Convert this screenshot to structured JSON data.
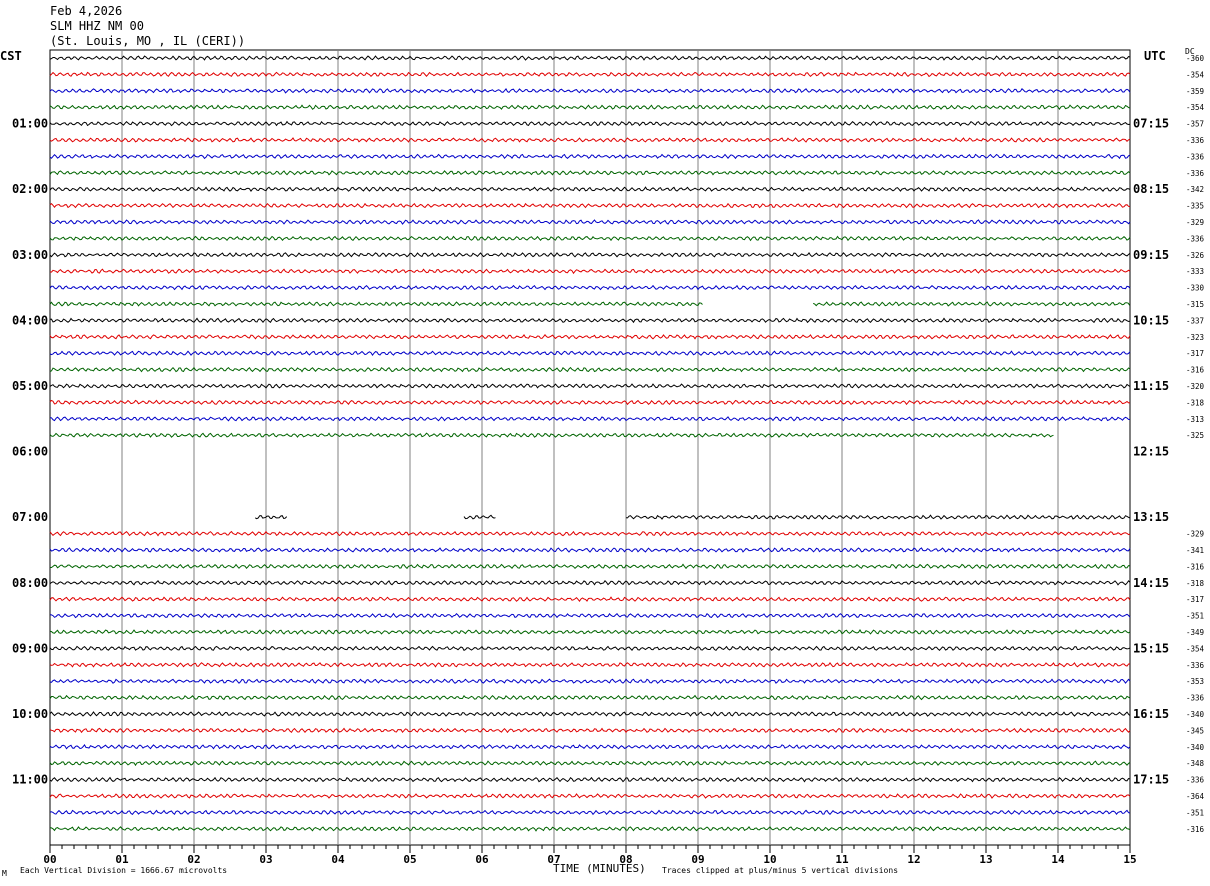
{
  "header": {
    "date": "Feb 4,2026",
    "station": "SLM HHZ NM 00",
    "location": "(St. Louis, MO , IL (CERI))"
  },
  "labels": {
    "left_tz": "CST",
    "right_tz": "UTC",
    "dc_header": "DC"
  },
  "footer": {
    "left": "Each Vertical Division = 1666.67 microvolts",
    "center": "TIME (MINUTES)",
    "right": "Traces clipped at plus/minus 5 vertical divisions",
    "mark": "M"
  },
  "chart_data": {
    "type": "line",
    "xlabel": "TIME (MINUTES)",
    "xlim": [
      0,
      15
    ],
    "x_ticks": [
      "00",
      "01",
      "02",
      "03",
      "04",
      "05",
      "06",
      "07",
      "08",
      "09",
      "10",
      "11",
      "12",
      "13",
      "14",
      "15"
    ],
    "trace_colors": [
      "#000000",
      "#e00000",
      "#0000c8",
      "#006400"
    ],
    "left_time_labels": [
      "01:00",
      "02:00",
      "03:00",
      "04:00",
      "05:00",
      "06:00",
      "07:00",
      "08:00",
      "09:00",
      "10:00",
      "11:00"
    ],
    "right_time_labels": [
      "07:15",
      "08:15",
      "09:15",
      "10:15",
      "11:15",
      "12:15",
      "13:15",
      "14:15",
      "15:15",
      "16:15",
      "17:15"
    ],
    "traces": [
      {
        "dc": "-360",
        "segments": [
          [
            0,
            15
          ]
        ]
      },
      {
        "dc": "-354",
        "segments": [
          [
            0,
            15
          ]
        ]
      },
      {
        "dc": "-359",
        "segments": [
          [
            0,
            15
          ]
        ]
      },
      {
        "dc": "-354",
        "segments": [
          [
            0,
            15
          ]
        ]
      },
      {
        "dc": "-357",
        "segments": [
          [
            0,
            15
          ]
        ]
      },
      {
        "dc": "-336",
        "segments": [
          [
            0,
            15
          ]
        ]
      },
      {
        "dc": "-336",
        "segments": [
          [
            0,
            15
          ]
        ]
      },
      {
        "dc": "-336",
        "segments": [
          [
            0,
            15
          ]
        ]
      },
      {
        "dc": "-342",
        "segments": [
          [
            0,
            15
          ]
        ]
      },
      {
        "dc": "-335",
        "segments": [
          [
            0,
            15
          ]
        ]
      },
      {
        "dc": "-329",
        "segments": [
          [
            0,
            15
          ]
        ]
      },
      {
        "dc": "-336",
        "segments": [
          [
            0,
            15
          ]
        ]
      },
      {
        "dc": "-326",
        "segments": [
          [
            0,
            15
          ]
        ]
      },
      {
        "dc": "-333",
        "segments": [
          [
            0,
            15
          ]
        ]
      },
      {
        "dc": "-330",
        "segments": [
          [
            0,
            15
          ]
        ]
      },
      {
        "dc": "-315",
        "segments": [
          [
            0,
            9.08
          ],
          [
            10.6,
            15
          ]
        ]
      },
      {
        "dc": "-337",
        "segments": [
          [
            0,
            15
          ]
        ]
      },
      {
        "dc": "-323",
        "segments": [
          [
            0,
            15
          ]
        ]
      },
      {
        "dc": "-317",
        "segments": [
          [
            0,
            15
          ]
        ]
      },
      {
        "dc": "-316",
        "segments": [
          [
            0,
            15
          ]
        ]
      },
      {
        "dc": "-320",
        "segments": [
          [
            0,
            15
          ]
        ]
      },
      {
        "dc": "-318",
        "segments": [
          [
            0,
            15
          ]
        ]
      },
      {
        "dc": "-313",
        "segments": [
          [
            0,
            15
          ]
        ]
      },
      {
        "dc": "-325",
        "segments": [
          [
            0,
            13.95
          ]
        ]
      },
      {
        "dc": "",
        "segments": []
      },
      {
        "dc": "",
        "segments": []
      },
      {
        "dc": "",
        "segments": []
      },
      {
        "dc": "",
        "segments": []
      },
      {
        "dc": "",
        "segments": [
          [
            2.85,
            3.3
          ],
          [
            5.75,
            6.2
          ],
          [
            8.0,
            15
          ]
        ]
      },
      {
        "dc": "-329",
        "segments": [
          [
            0,
            15
          ]
        ]
      },
      {
        "dc": "-341",
        "segments": [
          [
            0,
            15
          ]
        ]
      },
      {
        "dc": "-316",
        "segments": [
          [
            0,
            15
          ]
        ]
      },
      {
        "dc": "-318",
        "segments": [
          [
            0,
            15
          ]
        ]
      },
      {
        "dc": "-317",
        "segments": [
          [
            0,
            15
          ]
        ]
      },
      {
        "dc": "-351",
        "segments": [
          [
            0,
            15
          ]
        ]
      },
      {
        "dc": "-349",
        "segments": [
          [
            0,
            15
          ]
        ]
      },
      {
        "dc": "-354",
        "segments": [
          [
            0,
            15
          ]
        ]
      },
      {
        "dc": "-336",
        "segments": [
          [
            0,
            15
          ]
        ]
      },
      {
        "dc": "-353",
        "segments": [
          [
            0,
            15
          ]
        ]
      },
      {
        "dc": "-336",
        "segments": [
          [
            0,
            15
          ]
        ]
      },
      {
        "dc": "-340",
        "segments": [
          [
            0,
            15
          ]
        ]
      },
      {
        "dc": "-345",
        "segments": [
          [
            0,
            15
          ]
        ]
      },
      {
        "dc": "-340",
        "segments": [
          [
            0,
            15
          ]
        ]
      },
      {
        "dc": "-348",
        "segments": [
          [
            0,
            15
          ]
        ]
      },
      {
        "dc": "-336",
        "segments": [
          [
            0,
            15
          ]
        ]
      },
      {
        "dc": "-364",
        "segments": [
          [
            0,
            15
          ]
        ]
      },
      {
        "dc": "-351",
        "segments": [
          [
            0,
            15
          ]
        ]
      },
      {
        "dc": "-316",
        "segments": [
          [
            0,
            15
          ]
        ]
      }
    ]
  }
}
